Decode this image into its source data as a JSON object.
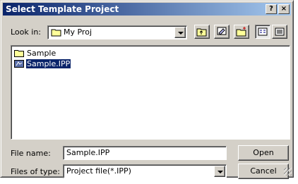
{
  "window": {
    "title": "Select Template Project",
    "help_label": "?",
    "close_label": "×"
  },
  "look_in": {
    "label": "Look in:",
    "value": "My Proj"
  },
  "toolbar": {
    "up_icon": "up-folder-icon",
    "desktop_icon": "desktop-icon",
    "new_folder_icon": "new-folder-icon",
    "list_view_icon": "list-view-icon",
    "details_view_icon": "details-view-icon"
  },
  "files": [
    {
      "name": "Sample",
      "type": "folder",
      "selected": false
    },
    {
      "name": "Sample.IPP",
      "type": "file",
      "selected": true
    }
  ],
  "file_name": {
    "label": "File name:",
    "value": "Sample.IPP"
  },
  "files_of_type": {
    "label": "Files of type:",
    "value": "Project file(*.IPP)"
  },
  "buttons": {
    "open": "Open",
    "cancel": "Cancel"
  },
  "colors": {
    "title_start": "#0a246a",
    "title_end": "#a6caf0",
    "face": "#d4d0c8",
    "selection": "#0a246a"
  }
}
